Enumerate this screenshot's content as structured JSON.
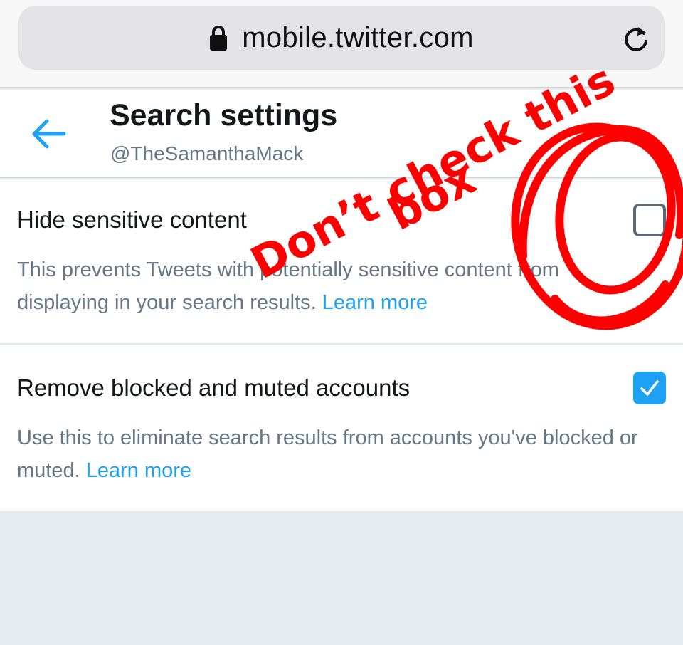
{
  "browser": {
    "url": "mobile.twitter.com",
    "lock_icon": "lock-icon",
    "reload_icon": "reload-icon"
  },
  "header": {
    "title": "Search settings",
    "handle": "@TheSamanthaMack",
    "back_icon": "back-arrow-icon"
  },
  "settings": [
    {
      "title": "Hide sensitive content",
      "description": "This prevents Tweets with potentially sensitive content from displaying in your search results.",
      "link": "Learn more",
      "checked": false
    },
    {
      "title": "Remove blocked and muted accounts",
      "description": "Use this to eliminate search results from accounts you've blocked or muted.",
      "link": "Learn more",
      "checked": true
    }
  ],
  "annotation": {
    "line1": "Don’t check this",
    "line2": "box",
    "color": "#ff0000"
  },
  "colors": {
    "accent": "#1da1f2",
    "text_primary": "#14171a",
    "text_secondary": "#657786",
    "page_background": "#e6ecf0"
  }
}
